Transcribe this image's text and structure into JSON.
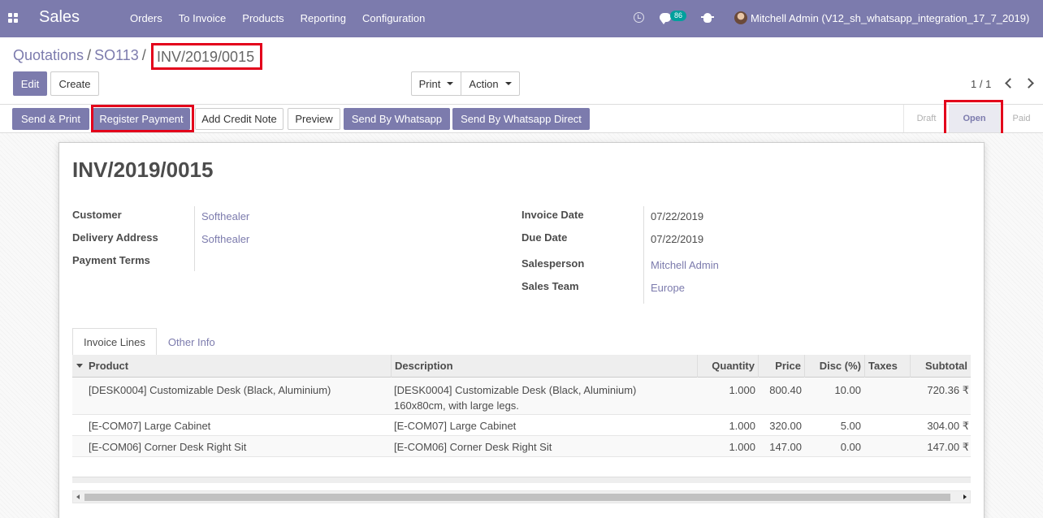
{
  "navbar": {
    "app_name": "Sales",
    "menu": [
      "Orders",
      "To Invoice",
      "Products",
      "Reporting",
      "Configuration"
    ],
    "chat_count": "86",
    "user": "Mitchell Admin (V12_sh_whatsapp_integration_17_7_2019)"
  },
  "breadcrumb": {
    "items": [
      "Quotations",
      "SO113"
    ],
    "current": "INV/2019/0015"
  },
  "controls": {
    "edit": "Edit",
    "create": "Create",
    "print": "Print",
    "action": "Action",
    "pager": "1 / 1"
  },
  "statusbar": {
    "buttons": [
      "Send & Print",
      "Register Payment",
      "Add Credit Note",
      "Preview",
      "Send By Whatsapp",
      "Send By Whatsapp Direct"
    ],
    "stages": [
      "Draft",
      "Open",
      "Paid"
    ],
    "active_stage": "Open"
  },
  "invoice": {
    "title": "INV/2019/0015",
    "left_fields": [
      {
        "label": "Customer",
        "value": "Softhealer"
      },
      {
        "label": "Delivery Address",
        "value": "Softhealer"
      },
      {
        "label": "Payment Terms",
        "value": ""
      }
    ],
    "right_fields": [
      {
        "label": "Invoice Date",
        "value": "07/22/2019"
      },
      {
        "label": "Due Date",
        "value": "07/22/2019"
      },
      {
        "label": "Salesperson",
        "value": "Mitchell Admin"
      },
      {
        "label": "Sales Team",
        "value": "Europe"
      }
    ]
  },
  "tabs": [
    "Invoice Lines",
    "Other Info"
  ],
  "lines": {
    "headers": [
      "Product",
      "Description",
      "Quantity",
      "Price",
      "Disc (%)",
      "Taxes",
      "Subtotal"
    ],
    "rows": [
      {
        "product": "[DESK0004] Customizable Desk (Black, Aluminium)",
        "description": "[DESK0004] Customizable Desk (Black, Aluminium)",
        "description2": "160x80cm, with large legs.",
        "quantity": "1.000",
        "price": "800.40",
        "disc": "10.00",
        "taxes": "",
        "subtotal": "720.36 ₹"
      },
      {
        "product": "[E-COM07] Large Cabinet",
        "description": "[E-COM07] Large Cabinet",
        "description2": "",
        "quantity": "1.000",
        "price": "320.00",
        "disc": "5.00",
        "taxes": "",
        "subtotal": "304.00 ₹"
      },
      {
        "product": "[E-COM06] Corner Desk Right Sit",
        "description": "[E-COM06] Corner Desk Right Sit",
        "description2": "",
        "quantity": "1.000",
        "price": "147.00",
        "disc": "0.00",
        "taxes": "",
        "subtotal": "147.00 ₹"
      }
    ]
  },
  "colors": {
    "brand": "#7c7bad",
    "highlight": "#e3001b",
    "badge": "#00a09d"
  }
}
